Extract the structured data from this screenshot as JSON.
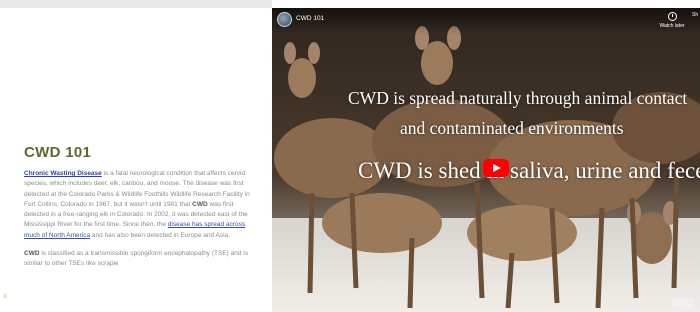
{
  "article": {
    "heading": "CWD 101",
    "p1": {
      "link_cwd": "Chronic Wasting Disease",
      "text_a": " is a fatal neurological condition that affects cervid species, which includes deer, elk, caribou, and moose. The disease was first detected at the Colorado Parks & Wildlife Foothills Wildlife Research Facility in Fort Collins, Colorado in 1967, but it wasn't until 1981 that ",
      "bold_cwd": "CWD",
      "text_b": " was first detected in a free-ranging elk in Colorado. In 2002, it was detected east of the Mississippi River for the first time. Since then, the ",
      "link_spread": "disease has spread across much of North America",
      "text_c": " and has also been detected in Europe and Asia."
    },
    "p2": {
      "bold_cwd": "CWD",
      "text": " is classified as a transmissible spongiform encephalopathy (TSE) and is similar to other TSEs like scrapie"
    },
    "side_mark": "ii"
  },
  "video": {
    "title": "CWD 101",
    "watch_later": "Watch later",
    "share_cut": "Sh",
    "caption_line1": "CWD is spread naturally through animal contact",
    "caption_line2": "and contaminated environments",
    "caption_line3": "CWD is shed in saliva, urine and feces."
  },
  "colors": {
    "heading_green": "#5a6b2c",
    "link_blue": "#2f3eb5",
    "play_red": "#ff0000"
  }
}
